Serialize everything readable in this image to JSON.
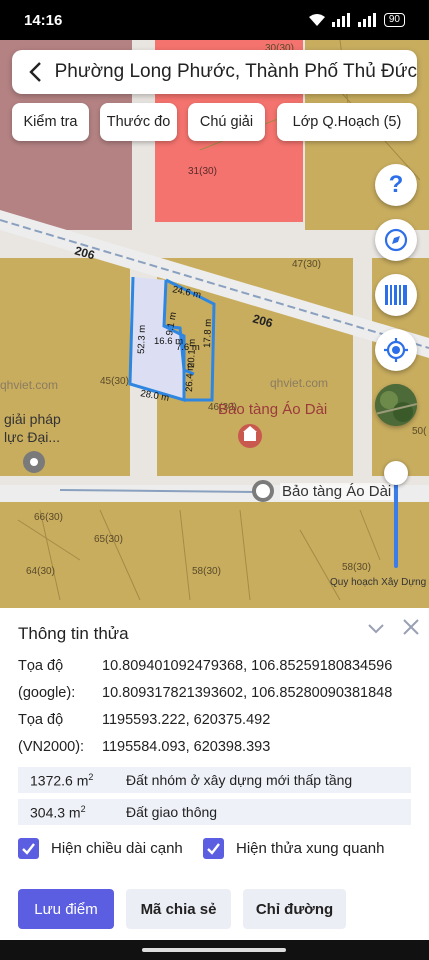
{
  "status": {
    "time": "14:16",
    "battery": "90"
  },
  "search": {
    "title": "Phường Long Phước, Thành Phố Thủ Đức"
  },
  "toolbar": {
    "check": "Kiểm tra",
    "ruler": "Thước đo",
    "legend": "Chú giải",
    "layers": "Lớp Q.Hoạch (5)"
  },
  "fab": {
    "help": "?"
  },
  "map_labels": {
    "road": "206",
    "road2": "206",
    "parcel_top": "30(30)",
    "parcel_red": "31(30)",
    "parcel_47": "47(30)",
    "parcel_45": "45(30)",
    "parcel_46": "46(30)",
    "parcel_66": "66(30)",
    "parcel_65": "65(30)",
    "parcel_64": "64(30)",
    "parcel_58a": "58(30)",
    "parcel_58b": "58(30)",
    "parcel_50": "50(",
    "watermark_left": "qhviet.com",
    "watermark_right": "qhviet.com",
    "left_text1": "giải pháp",
    "left_text2": "lực Đại...",
    "poi_label": "Bảo tàng Áo Dài",
    "poi_chip": "Bảo tàng Áo Dài",
    "dim_top": "24.6 m",
    "dim_left": "52.3 m",
    "dim_bottom": "28.0 m",
    "dim_right_a": "17.8 m",
    "dim_right_b": "26.4 m",
    "dim_inner_a": "16.6 m",
    "dim_inner_b": "20.1 m",
    "dim_inner_c": "7.6 m",
    "dim_inner_d": "9.1 m"
  },
  "slider": {
    "label": "Quy hoạch Xây Dựng",
    "value": 1.0
  },
  "sheet": {
    "title": "Thông tin thửa",
    "coords": [
      {
        "label": "Tọa độ",
        "value": "10.809401092479368, 106.85259180834596"
      },
      {
        "label": "(google):",
        "value": "10.809317821393602, 106.85280090381848"
      },
      {
        "label": "Tọa độ",
        "value": "1195593.222, 620375.492"
      },
      {
        "label": "(VN2000):",
        "value": "1195584.093, 620398.393"
      }
    ],
    "land": [
      {
        "area": "1372.6 m",
        "sup": "2",
        "type": "Đất nhóm ở xây dựng mới thấp tầng"
      },
      {
        "area": "304.3 m",
        "sup": "2",
        "type": "Đất giao thông"
      }
    ],
    "check_edges": "Hiện chiều dài cạnh",
    "check_neighbors": "Hiện thửa xung quanh",
    "save": "Lưu điểm",
    "share": "Mã chia sẻ",
    "directions": "Chỉ đường"
  },
  "colors": {
    "residential": "#c8ad5f",
    "commercial": "#f4736e",
    "mauve": "#b48283",
    "road": "#ededed",
    "accent": "#5b5ee0",
    "parcel_outline": "#2f86e0"
  },
  "icons": [
    "back-icon",
    "help-icon",
    "compass-icon",
    "barcode-icon",
    "locate-icon",
    "satellite-icon",
    "chevron-down-icon",
    "close-icon",
    "check-icon",
    "museum-icon",
    "location-pin-icon"
  ]
}
